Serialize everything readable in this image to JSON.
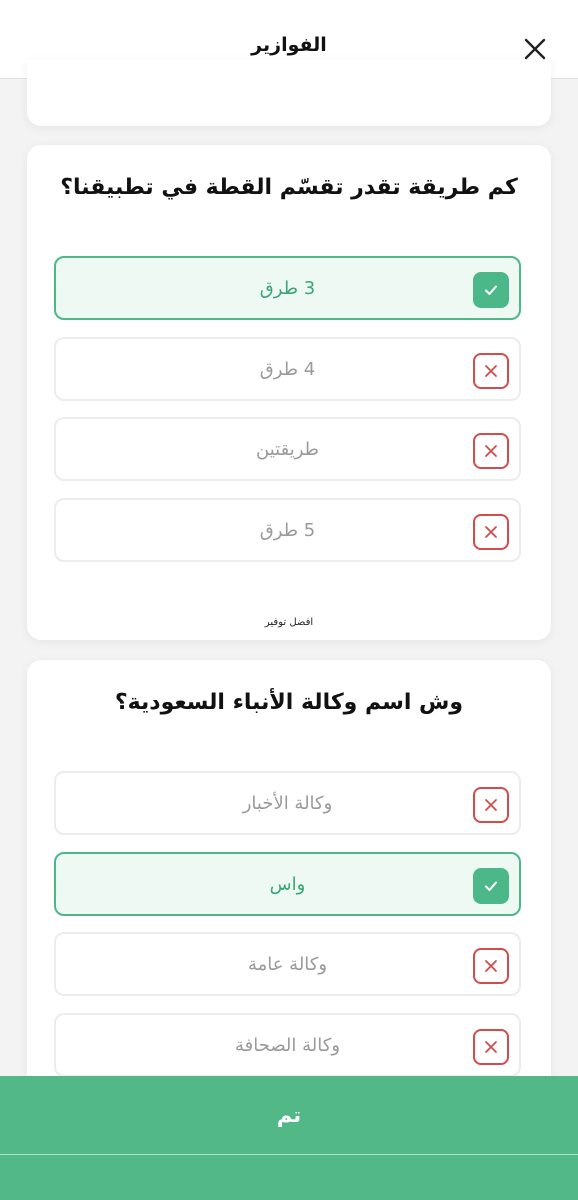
{
  "header": {
    "title": "الفوازير",
    "close_icon": "close-icon"
  },
  "questions": [
    {
      "question": "كم طريقة تقدر تقسّم القطة في تطبيقنا؟",
      "options": [
        {
          "label": "3 طرق",
          "state": "correct"
        },
        {
          "label": "4 طرق",
          "state": "wrong"
        },
        {
          "label": "طريقتين",
          "state": "wrong"
        },
        {
          "label": "5 طرق",
          "state": "wrong"
        }
      ],
      "footnote": "افضل توفير"
    },
    {
      "question": "وش اسم وكالة الأنباء السعودية؟",
      "options": [
        {
          "label": "وكالة الأخبار",
          "state": "wrong"
        },
        {
          "label": "واس",
          "state": "correct"
        },
        {
          "label": "وكالة عامة",
          "state": "wrong"
        },
        {
          "label": "وكالة الصحافة",
          "state": "wrong"
        }
      ]
    }
  ],
  "footer": {
    "done_label": "تم"
  },
  "colors": {
    "accent": "#52b887",
    "wrong": "#d44b4b"
  }
}
